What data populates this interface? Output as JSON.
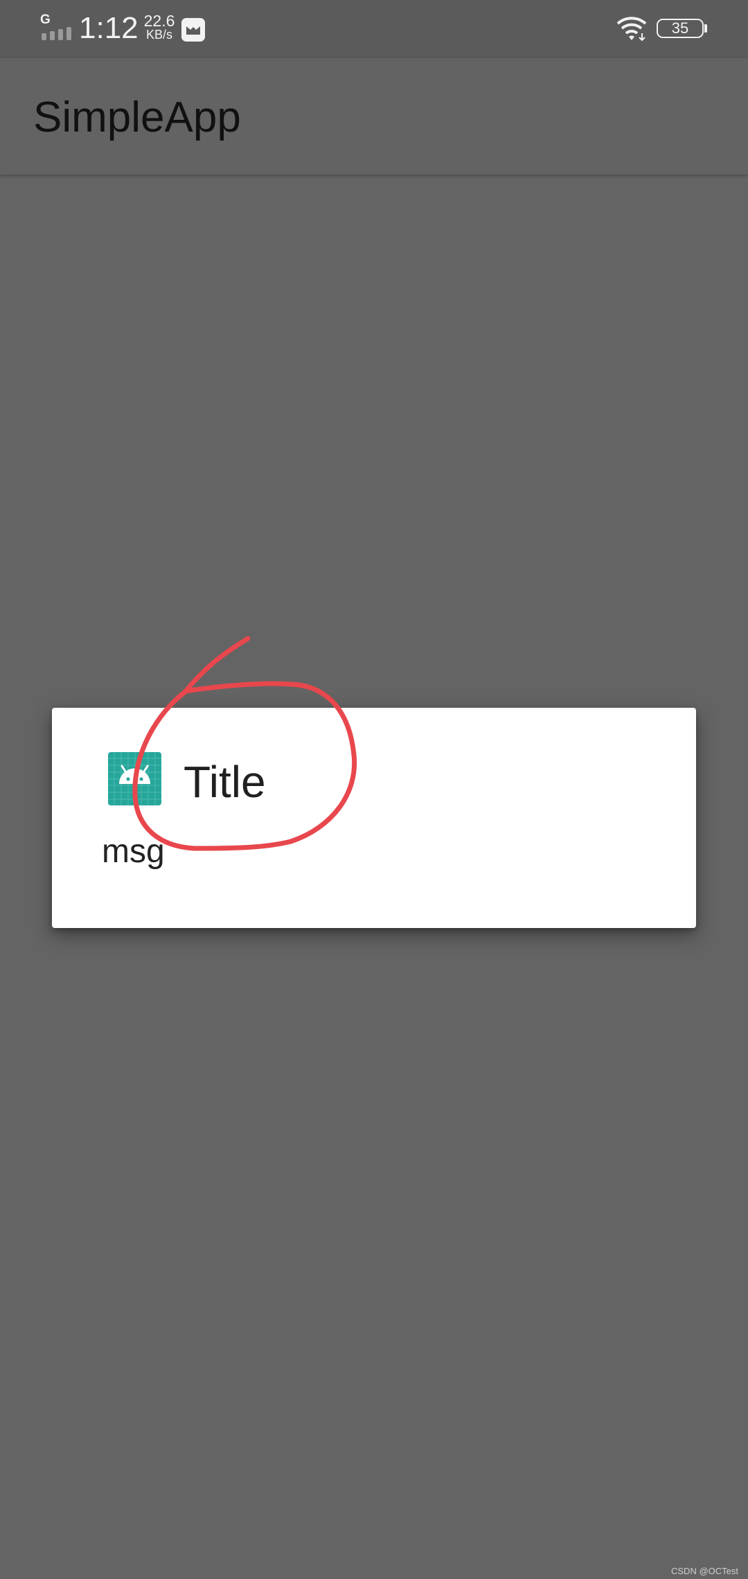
{
  "status_bar": {
    "network_type": "G",
    "time": "1:12",
    "net_speed_value": "22.6",
    "net_speed_unit": "KB/s",
    "battery_level": "35",
    "icons": [
      "signal-icon",
      "notification-icon",
      "wifi-icon",
      "battery-icon"
    ]
  },
  "toolbar": {
    "title": "SimpleApp"
  },
  "dialog": {
    "icon": "android-app-icon",
    "title": "Title",
    "message": "msg"
  },
  "annotation": {
    "color": "#e8474d",
    "shape": "hand-drawn circle around dialog title"
  },
  "watermark": "CSDN @OCTest",
  "colors": {
    "background": "#646464",
    "status_bar": "#5b5b5b",
    "dialog_bg": "#ffffff",
    "icon_teal": "#26a69a"
  }
}
